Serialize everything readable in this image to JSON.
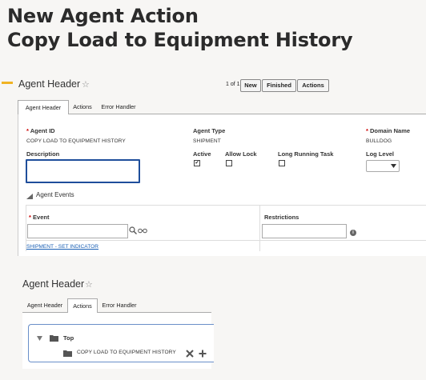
{
  "page": {
    "title_line1": "New Agent Action",
    "title_line2": "Copy Load to Equipment History"
  },
  "top_section": {
    "header_title": "Agent Header",
    "pager": "1 of 1",
    "buttons": {
      "new": "New",
      "finished": "Finished",
      "actions": "Actions"
    },
    "tabs": [
      "Agent Header",
      "Actions",
      "Error Handler"
    ],
    "fields": {
      "agent_id_label": "Agent ID",
      "agent_id_value": "COPY LOAD TO EQUIPMENT HISTORY",
      "agent_type_label": "Agent Type",
      "agent_type_value": "SHIPMENT",
      "domain_name_label": "Domain Name",
      "domain_name_value": "BULLDOG",
      "description_label": "Description",
      "active_label": "Active",
      "active_checked": true,
      "allow_lock_label": "Allow Lock",
      "allow_lock_checked": false,
      "long_running_label": "Long Running Task",
      "long_running_checked": false,
      "log_level_label": "Log Level"
    },
    "agent_events": {
      "section_label": "Agent Events",
      "event_header": "Event",
      "restrictions_header": "Restrictions",
      "rows": [
        "SHIPMENT - SET INDICATOR"
      ]
    }
  },
  "bottom_section": {
    "header_title": "Agent Header",
    "tabs": [
      "Agent Header",
      "Actions",
      "Error Handler"
    ],
    "active_tab": "Actions",
    "tree": {
      "root": "Top",
      "child": "COPY LOAD TO EQUIPMENT HISTORY"
    }
  },
  "colors": {
    "accent": "#f0b323",
    "link": "#1a5fb4",
    "focus": "#1f4e9b"
  }
}
